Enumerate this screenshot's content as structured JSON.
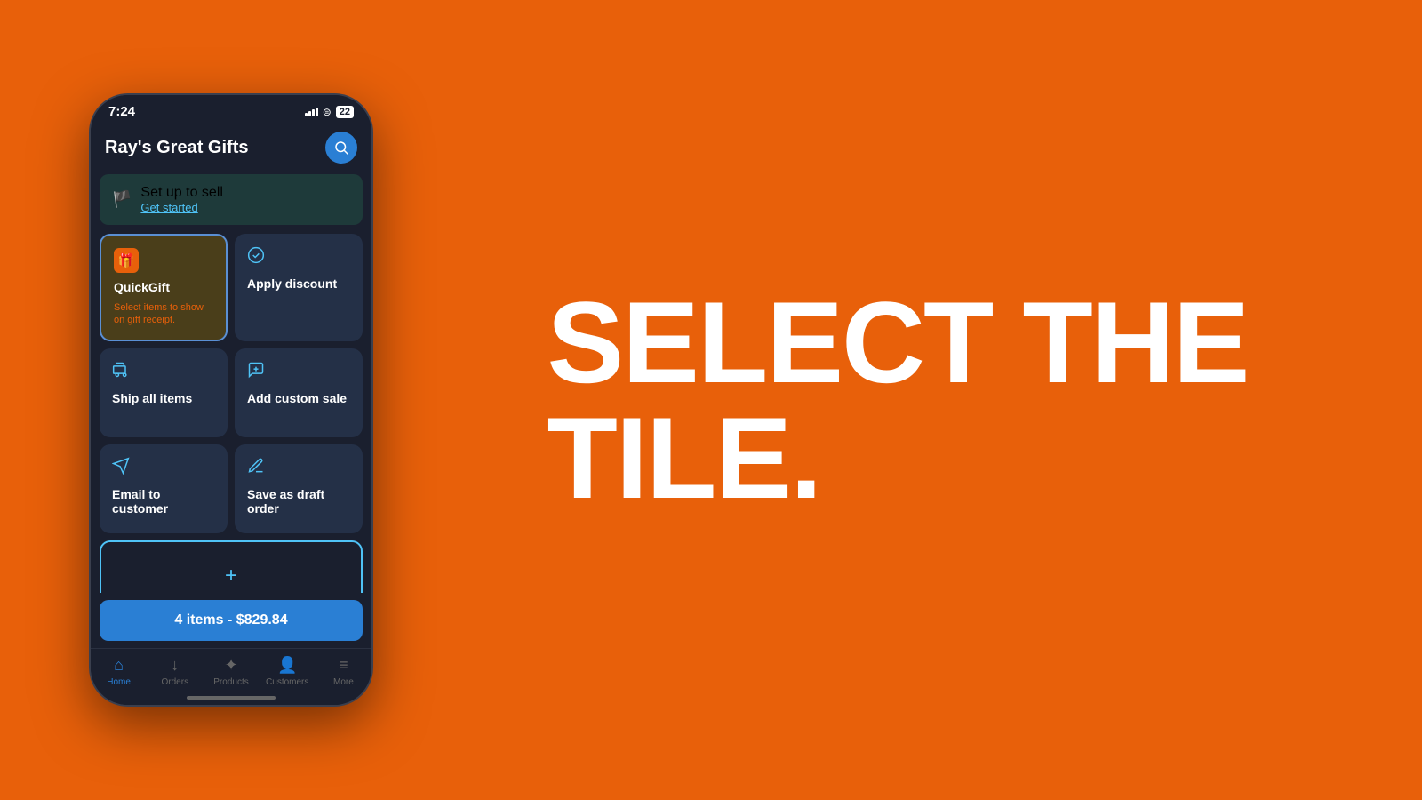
{
  "statusBar": {
    "time": "7:24",
    "battery": "22"
  },
  "header": {
    "title": "Ray's Great Gifts"
  },
  "setupBanner": {
    "title": "Set up to sell",
    "link": "Get started"
  },
  "tiles": [
    {
      "id": "quick-gift",
      "title": "QuickGift",
      "subtitle": "Select items to show on gift receipt.",
      "iconType": "gift",
      "highlighted": true
    },
    {
      "id": "apply-discount",
      "title": "Apply discount",
      "subtitle": "",
      "iconType": "discount",
      "highlighted": false
    },
    {
      "id": "ship-all-items",
      "title": "Ship all items",
      "subtitle": "",
      "iconType": "ship",
      "highlighted": false
    },
    {
      "id": "add-custom-sale",
      "title": "Add custom sale",
      "subtitle": "",
      "iconType": "custom",
      "highlighted": false
    },
    {
      "id": "email-to-customer",
      "title": "Email to customer",
      "subtitle": "",
      "iconType": "email",
      "highlighted": false
    },
    {
      "id": "save-as-draft",
      "title": "Save as draft order",
      "subtitle": "",
      "iconType": "draft",
      "highlighted": false
    }
  ],
  "cart": {
    "label": "4 items - $829.84"
  },
  "bottomNav": [
    {
      "id": "home",
      "label": "Home",
      "active": true
    },
    {
      "id": "orders",
      "label": "Orders",
      "active": false
    },
    {
      "id": "products",
      "label": "Products",
      "active": false
    },
    {
      "id": "customers",
      "label": "Customers",
      "active": false
    },
    {
      "id": "more",
      "label": "More",
      "active": false
    }
  ],
  "bigText": {
    "line1": "SELECT THE",
    "line2": "TILE."
  }
}
